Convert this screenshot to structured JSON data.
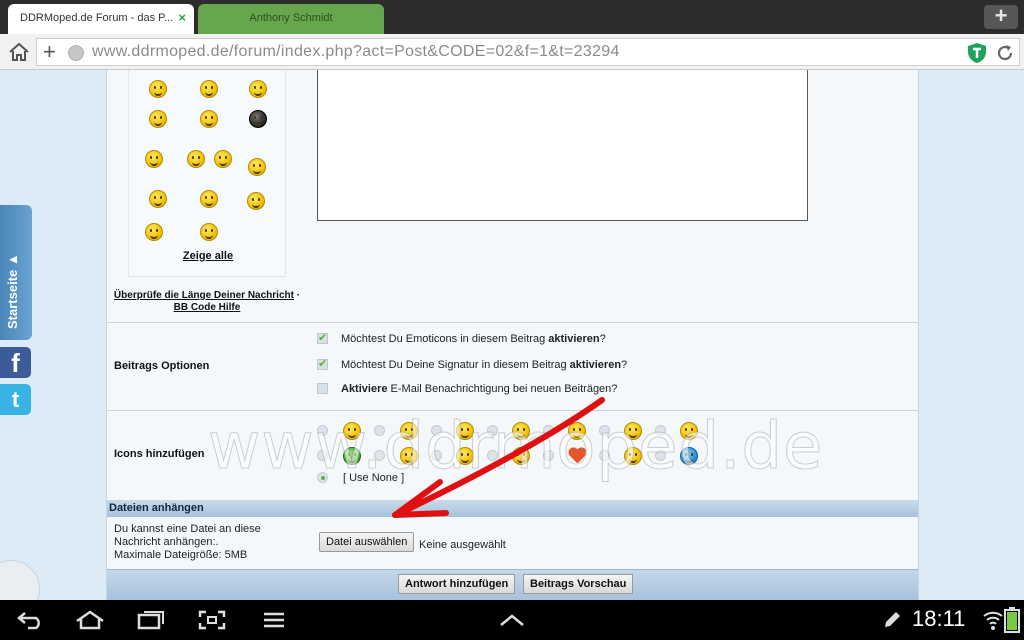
{
  "browser": {
    "active_tab_title": "DDRMoped.de Forum - das P...",
    "active_tab_close": "×",
    "inactive_tab_title": "Anthony Schmidt",
    "new_tab": "+",
    "url": "www.ddrmoped.de/forum/index.php?act=Post&CODE=02&f=1&t=23294"
  },
  "sidebar": {
    "startseite_label": "Startseite ▲",
    "facebook_glyph": "f",
    "twitter_glyph": "t"
  },
  "smilies": {
    "show_all": "Zeige alle",
    "check_length_link": "Überprüfe die Länge Deiner Nachricht",
    "separator": " ·",
    "bbcode_help": "BB Code Hilfe"
  },
  "options": {
    "label": "Beitrags Optionen",
    "items": [
      {
        "before": "Möchtest Du Emoticons in diesem Beitrag ",
        "bold": "aktivieren",
        "after": "?",
        "checked": true
      },
      {
        "before": "Möchtest Du Deine Signatur in diesem Beitrag ",
        "bold": "aktivieren",
        "after": "?",
        "checked": true
      },
      {
        "before": "",
        "bold": "Aktiviere",
        "after": " E-Mail Benachrichtigung bei neuen Beiträgen?",
        "checked": false
      }
    ]
  },
  "icons": {
    "label": "Icons hinzufügen",
    "use_none": "[ Use None ]"
  },
  "attachments": {
    "header": "Dateien anhängen",
    "text_line1": "Du kannst eine Datei an diese",
    "text_line2": "Nachricht anhängen:.",
    "text_line3": "Maximale Dateigröße: 5MB",
    "choose_button": "Datei auswählen",
    "no_file": "Keine ausgewählt"
  },
  "actions": {
    "submit": "Antwort hinzufügen",
    "preview": "Beitrags Vorschau"
  },
  "watermark": "www.ddrmoped.de",
  "status": {
    "time": "18:11"
  },
  "colors": {
    "header_blue": "#a6c2dc",
    "check_green": "#63b02a",
    "arrow_red": "#e01010"
  }
}
